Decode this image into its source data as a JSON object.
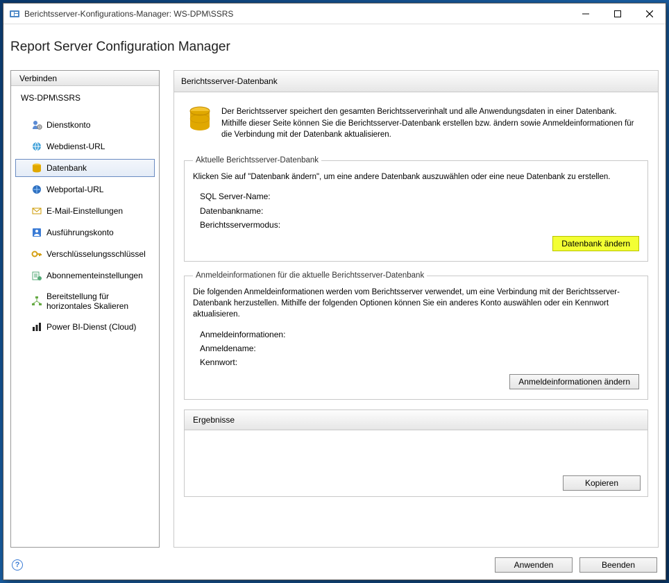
{
  "window_title": "Berichtsserver-Konfigurations-Manager: WS-DPM\\SSRS",
  "app_title": "Report Server Configuration Manager",
  "sidebar": {
    "header": "Verbinden",
    "server": "WS-DPM\\SSRS",
    "items": [
      {
        "label": "Dienstkonto",
        "icon": "service-account-icon"
      },
      {
        "label": "Webdienst-URL",
        "icon": "webservice-url-icon"
      },
      {
        "label": "Datenbank",
        "icon": "database-icon",
        "selected": true
      },
      {
        "label": "Webportal-URL",
        "icon": "webportal-url-icon"
      },
      {
        "label": "E-Mail-Einstellungen",
        "icon": "email-settings-icon"
      },
      {
        "label": "Ausführungskonto",
        "icon": "execution-account-icon"
      },
      {
        "label": "Verschlüsselungsschlüssel",
        "icon": "encryption-keys-icon"
      },
      {
        "label": "Abonnementeinstellungen",
        "icon": "subscription-settings-icon"
      },
      {
        "label": "Bereitstellung für horizontales Skalieren",
        "icon": "scaleout-icon"
      },
      {
        "label": "Power BI-Dienst (Cloud)",
        "icon": "powerbi-icon"
      }
    ]
  },
  "panel": {
    "title": "Berichtsserver-Datenbank",
    "intro": "Der Berichtsserver speichert den gesamten Berichtsserverinhalt und alle Anwendungsdaten in einer Datenbank. Mithilfe dieser Seite können Sie die Berichtsserver-Datenbank erstellen bzw. ändern sowie Anmeldeinformationen für die Verbindung mit der Datenbank aktualisieren.",
    "group1": {
      "legend": "Aktuelle Berichtsserver-Datenbank",
      "help": "Klicken Sie auf \"Datenbank ändern\", um eine andere Datenbank auszuwählen oder eine neue Datenbank zu erstellen.",
      "field1": "SQL Server-Name:",
      "field2": "Datenbankname:",
      "field3": "Berichtsservermodus:",
      "button": "Datenbank ändern"
    },
    "group2": {
      "legend": "Anmeldeinformationen für die aktuelle Berichtsserver-Datenbank",
      "help": "Die folgenden Anmeldeinformationen werden vom Berichtsserver verwendet, um eine Verbindung mit der Berichtsserver-Datenbank herzustellen. Mithilfe der folgenden Optionen können Sie ein anderes Konto auswählen oder ein Kennwort aktualisieren.",
      "field1": "Anmeldeinformationen:",
      "field2": "Anmeldename:",
      "field3": "Kennwort:",
      "button": "Anmeldeinformationen ändern"
    },
    "results_label": "Ergebnisse",
    "copy_label": "Kopieren"
  },
  "footer": {
    "apply": "Anwenden",
    "exit": "Beenden"
  }
}
